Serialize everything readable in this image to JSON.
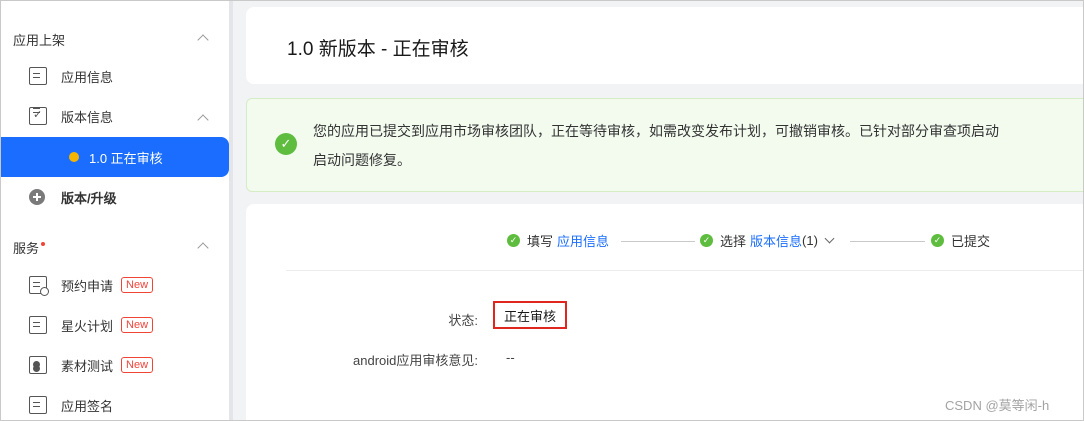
{
  "sidebar": {
    "section1": "应用上架",
    "app_info": "应用信息",
    "version_info": "版本信息",
    "active_version": "1.0 正在审核",
    "version_upgrade": "版本/升级",
    "section2": "服务",
    "items": [
      {
        "label": "预约申请",
        "badge": "New"
      },
      {
        "label": "星火计划",
        "badge": "New"
      },
      {
        "label": "素材测试",
        "badge": "New"
      },
      {
        "label": "应用签名"
      }
    ]
  },
  "main": {
    "title": "1.0 新版本 - 正在审核",
    "alert_line1": "您的应用已提交到应用市场审核团队，正在等待审核，如需改变发布计划，可撤销审核。已针对部分审查项启动",
    "alert_line2": "启动问题修复。",
    "steps": {
      "s1_prefix": "填写",
      "s1_link": "应用信息",
      "s2_prefix": "选择",
      "s2_link": "版本信息",
      "s2_count": "(1)",
      "s3": "已提交"
    },
    "status_label": "状态:",
    "status_value": "正在审核",
    "review_label": "android应用审核意见:",
    "review_value": "--"
  },
  "watermark": "CSDN @莫等闲-h",
  "colors": {
    "accent": "#1a6dff",
    "success": "#5ebd3e",
    "badge": "#f04438"
  }
}
